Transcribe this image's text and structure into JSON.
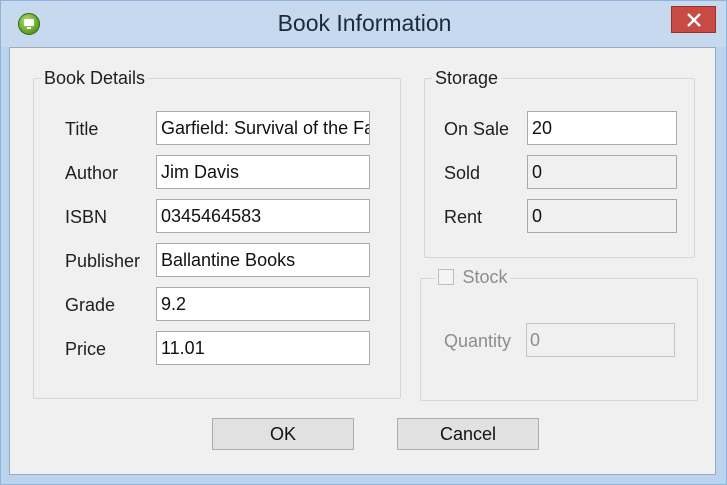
{
  "window": {
    "title": "Book Information",
    "app_icon": "monitor-icon",
    "close_icon": "close-icon"
  },
  "book_details": {
    "legend": "Book Details",
    "fields": [
      {
        "label": "Title",
        "value": "Garfield: Survival of the Fattest"
      },
      {
        "label": "Author",
        "value": "Jim Davis"
      },
      {
        "label": "ISBN",
        "value": "0345464583"
      },
      {
        "label": "Publisher",
        "value": "Ballantine Books"
      },
      {
        "label": "Grade",
        "value": "9.2"
      },
      {
        "label": "Price",
        "value": "11.01"
      }
    ]
  },
  "storage": {
    "legend": "Storage",
    "fields": [
      {
        "label": "On Sale",
        "value": "20"
      },
      {
        "label": "Sold",
        "value": "0"
      },
      {
        "label": "Rent",
        "value": "0"
      }
    ]
  },
  "stock": {
    "legend": "Stock",
    "checked": false,
    "quantity_label": "Quantity",
    "quantity_value": "0"
  },
  "buttons": {
    "ok": "OK",
    "cancel": "Cancel"
  },
  "colors": {
    "title_bar": "#c6d9ef",
    "close_button": "#c74a44",
    "dialog_body": "#f0f0f0"
  }
}
